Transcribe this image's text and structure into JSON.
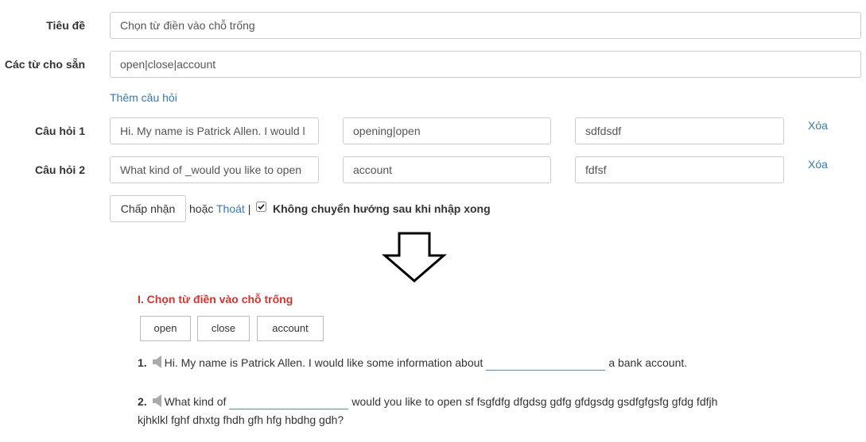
{
  "form": {
    "title_label": "Tiêu đề",
    "title_value": "Chọn từ điền vào chỗ trống",
    "words_label": "Các từ cho sẵn",
    "words_value": "open|close|account",
    "add_question_link": "Thêm câu hỏi",
    "questions": [
      {
        "label": "Câu hỏi 1",
        "text": "Hi. My name is Patrick Allen. I would l",
        "answers": "opening|open",
        "extra": "sdfdsdf",
        "delete": "Xóa"
      },
      {
        "label": "Câu hỏi 2",
        "text": "What kind of _would you like to open",
        "answers": "account",
        "extra": "fdfsf",
        "delete": "Xóa"
      }
    ],
    "accept_button": "Chấp nhận",
    "or_text": "hoặc",
    "exit_link": "Thoát",
    "separator": "|",
    "no_redirect_checked": true,
    "no_redirect_label": "Không chuyển hướng sau khi nhập xong"
  },
  "preview": {
    "heading": "I. Chọn từ điền vào chỗ trống",
    "heading_color": "#d9322e",
    "word_bank": [
      "open",
      "close",
      "account"
    ],
    "questions": [
      {
        "number": "1.",
        "before": "Hi. My name is Patrick Allen. I would like some information about",
        "after": "a bank account."
      },
      {
        "number": "2.",
        "before": "What kind of",
        "after": "would you like to open sf fsgfdfg dfgdsg gdfg gfdgsdg gsdfgfgsfg gfdg fdfjh",
        "continuation": "kjhklkl fghf dhxtg fhdh gfh hfg hbdhg gdh?"
      }
    ]
  },
  "icons": {
    "arrow": "down-arrow-icon",
    "speaker": "speaker-icon",
    "checkbox": "checkbox-checked-icon"
  },
  "colors": {
    "link": "#337ab7",
    "accent_red": "#d9322e",
    "blank_underline": "#4a90c8"
  }
}
